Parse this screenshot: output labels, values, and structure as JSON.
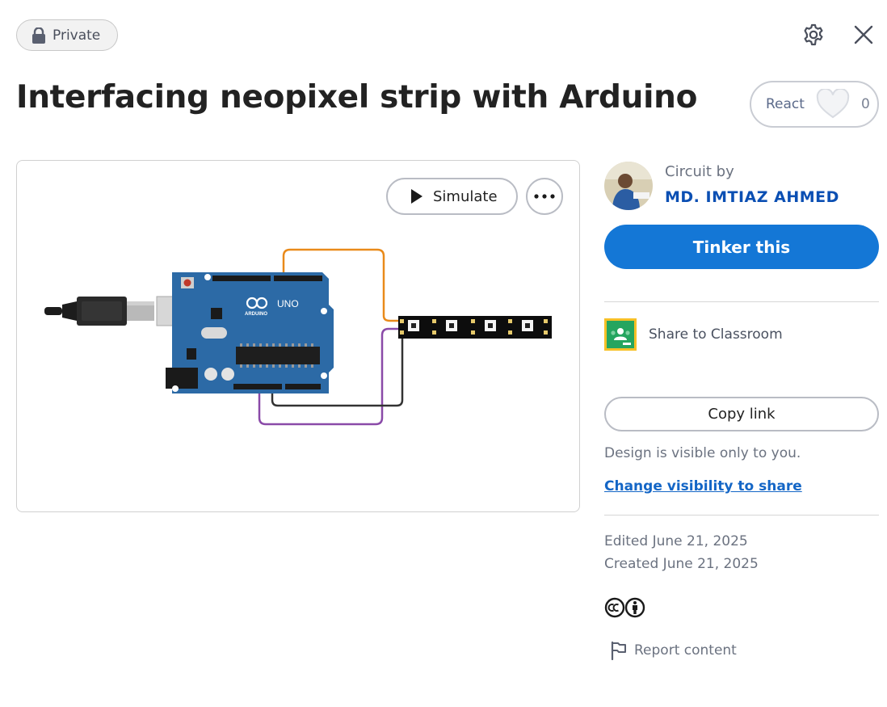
{
  "header": {
    "visibility_badge": "Private",
    "settings_icon": "gear-icon",
    "close_icon": "close-icon"
  },
  "title": "Interfacing neopixel strip with Arduino",
  "react": {
    "label": "React",
    "count": "0",
    "icon": "heart-icon"
  },
  "preview": {
    "simulate_label": "Simulate",
    "more_icon": "more-icon",
    "board_logo": "UNO",
    "board_brand": "ARDUINO"
  },
  "author": {
    "caption": "Circuit by",
    "name": "MD. IMTIAZ AHMED"
  },
  "actions": {
    "tinker_label": "Tinker this",
    "classroom_label": "Share to Classroom",
    "copy_link_label": "Copy link"
  },
  "visibility": {
    "note": "Design is visible only to you.",
    "change_link": "Change visibility to share"
  },
  "dates": {
    "edited": "Edited June 21, 2025",
    "created": "Created June 21, 2025"
  },
  "footer": {
    "license_icon": "cc-by-icon",
    "report_label": "Report content",
    "report_icon": "flag-icon"
  },
  "colors": {
    "primary": "#1477d6",
    "link": "#1466c6",
    "author": "#0b4fb3",
    "board": "#2c6aa6",
    "wire_orange": "#e98a1a",
    "wire_purple": "#8a4aa8",
    "wire_black": "#333333"
  }
}
